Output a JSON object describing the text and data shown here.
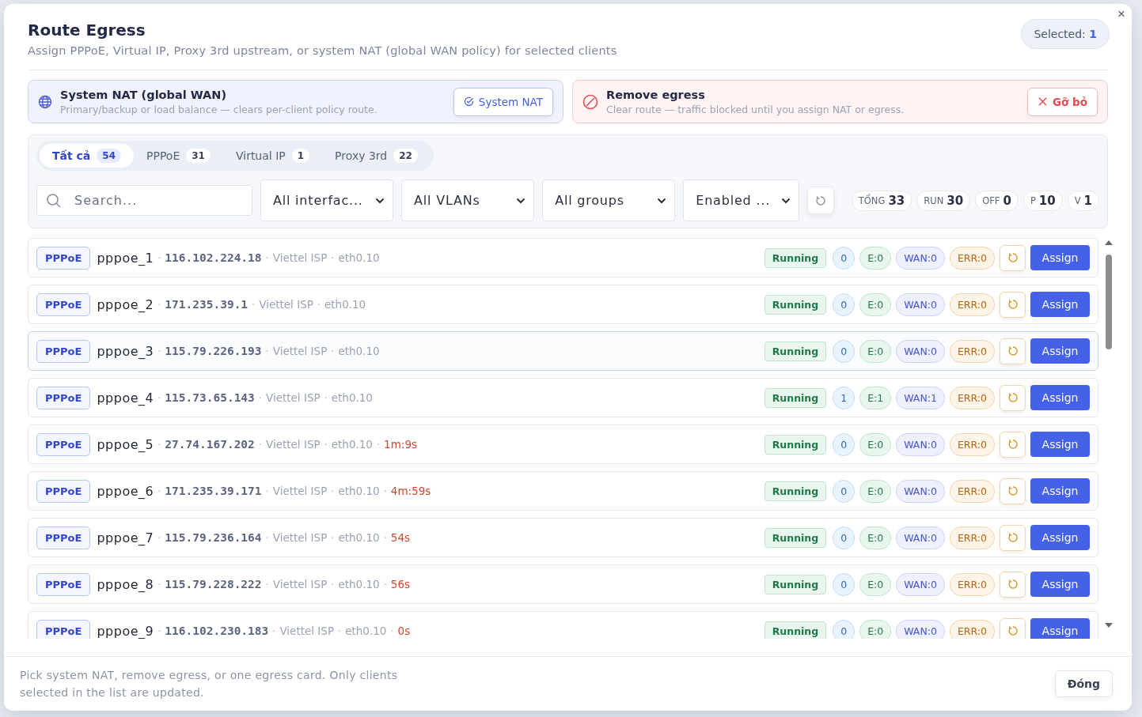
{
  "dialog": {
    "title": "Route Egress",
    "subtitle": "Assign PPPoE, Virtual IP, Proxy 3rd upstream, or system NAT (global WAN policy) for selected clients",
    "selected_label": "Selected:",
    "selected_count": "1",
    "close": "×"
  },
  "options": [
    {
      "kind": "nat",
      "title": "System NAT (global WAN)",
      "description": "Primary/backup or load balance — clears per-client policy route.",
      "button": "System NAT"
    },
    {
      "kind": "remove",
      "title": "Remove egress",
      "description": "Clear route — traffic blocked until you assign NAT or egress.",
      "button": "Gỡ bỏ"
    }
  ],
  "tabs": [
    {
      "label": "Tất cả",
      "count": "54",
      "selected": true
    },
    {
      "label": "PPPoE",
      "count": "31",
      "selected": false
    },
    {
      "label": "Virtual IP",
      "count": "1",
      "selected": false
    },
    {
      "label": "Proxy 3rd",
      "count": "22",
      "selected": false
    }
  ],
  "search": {
    "placeholder": "Search..."
  },
  "separator": "·",
  "filters": [
    "All interfac...",
    "All VLANs",
    "All groups",
    "Enabled ..."
  ],
  "stats": [
    {
      "label": "TỔNG",
      "value": "33"
    },
    {
      "label": "RUN",
      "value": "30"
    },
    {
      "label": "OFF",
      "value": "0"
    },
    {
      "label": "P",
      "value": "10"
    },
    {
      "label": "V",
      "value": "1"
    }
  ],
  "rows": [
    {
      "type": "PPPoE",
      "name": "pppoe_1",
      "ip": "116.102.224.18",
      "isp": "Viettel ISP",
      "iface": "eth0.10",
      "status": "Running",
      "count": "0",
      "e": "E:0",
      "wan": "WAN:0",
      "err": "ERR:0",
      "button": "Assign",
      "selected": false
    },
    {
      "type": "PPPoE",
      "name": "pppoe_2",
      "ip": "171.235.39.1",
      "isp": "Viettel ISP",
      "iface": "eth0.10",
      "status": "Running",
      "count": "0",
      "e": "E:0",
      "wan": "WAN:0",
      "err": "ERR:0",
      "button": "Assign",
      "selected": false
    },
    {
      "type": "PPPoE",
      "name": "pppoe_3",
      "ip": "115.79.226.193",
      "isp": "Viettel ISP",
      "iface": "eth0.10",
      "status": "Running",
      "count": "0",
      "e": "E:0",
      "wan": "WAN:0",
      "err": "ERR:0",
      "button": "Assign",
      "selected": true
    },
    {
      "type": "PPPoE",
      "name": "pppoe_4",
      "ip": "115.73.65.143",
      "isp": "Viettel ISP",
      "iface": "eth0.10",
      "status": "Running",
      "count": "1",
      "e": "E:1",
      "wan": "WAN:1",
      "err": "ERR:0",
      "button": "Assign",
      "selected": false
    },
    {
      "type": "PPPoE",
      "name": "pppoe_5",
      "ip": "27.74.167.202",
      "isp": "Viettel ISP",
      "iface": "eth0.10",
      "uptime": "1m:9s",
      "status": "Running",
      "count": "0",
      "e": "E:0",
      "wan": "WAN:0",
      "err": "ERR:0",
      "button": "Assign",
      "selected": false
    },
    {
      "type": "PPPoE",
      "name": "pppoe_6",
      "ip": "171.235.39.171",
      "isp": "Viettel ISP",
      "iface": "eth0.10",
      "uptime": "4m:59s",
      "status": "Running",
      "count": "0",
      "e": "E:0",
      "wan": "WAN:0",
      "err": "ERR:0",
      "button": "Assign",
      "selected": false
    },
    {
      "type": "PPPoE",
      "name": "pppoe_7",
      "ip": "115.79.236.164",
      "isp": "Viettel ISP",
      "iface": "eth0.10",
      "uptime": "54s",
      "status": "Running",
      "count": "0",
      "e": "E:0",
      "wan": "WAN:0",
      "err": "ERR:0",
      "button": "Assign",
      "selected": false
    },
    {
      "type": "PPPoE",
      "name": "pppoe_8",
      "ip": "115.79.228.222",
      "isp": "Viettel ISP",
      "iface": "eth0.10",
      "uptime": "56s",
      "status": "Running",
      "count": "0",
      "e": "E:0",
      "wan": "WAN:0",
      "err": "ERR:0",
      "button": "Assign",
      "selected": false
    },
    {
      "type": "PPPoE",
      "name": "pppoe_9",
      "ip": "116.102.230.183",
      "isp": "Viettel ISP",
      "iface": "eth0.10",
      "uptime": "0s",
      "status": "Running",
      "count": "0",
      "e": "E:0",
      "wan": "WAN:0",
      "err": "ERR:0",
      "button": "Assign",
      "selected": false
    }
  ],
  "footer": {
    "note": "Pick system NAT, remove egress, or one egress card. Only clients selected in the list are updated.",
    "button": "Đóng"
  }
}
